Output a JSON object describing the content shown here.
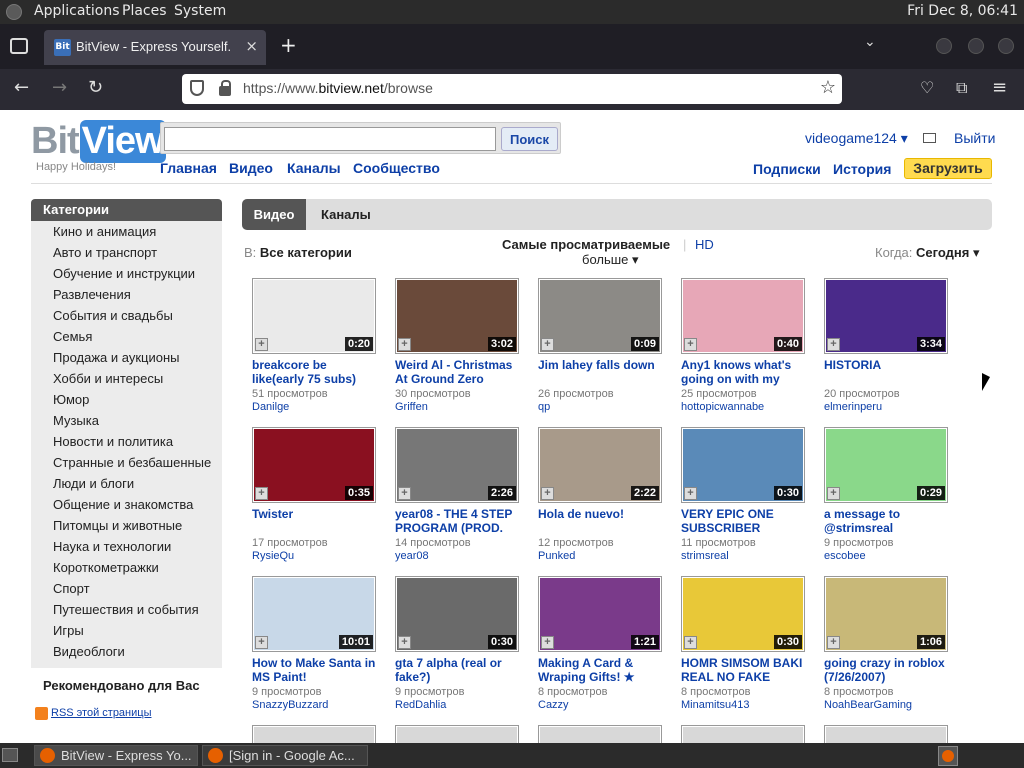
{
  "system_bar": {
    "menus": [
      "Applications",
      "Places",
      "System"
    ],
    "clock": "Fri Dec  8, 06:41"
  },
  "browser": {
    "tab_title": "BitView - Express Yourself.",
    "url_prefix": "https://www.",
    "url_domain": "bitview.net",
    "url_path": "/browse"
  },
  "site": {
    "logo_text": "BitView",
    "tagline": "Happy Holidays!",
    "search_button": "Поиск",
    "nav": [
      "Главная",
      "Видео",
      "Каналы",
      "Сообщество"
    ],
    "username": "videogame124",
    "logout": "Выйти",
    "subs": "Подписки",
    "history": "История",
    "upload": "Загрузить"
  },
  "sidebar": {
    "categories_title": "Категории",
    "categories": [
      "Кино и анимация",
      "Авто и транспорт",
      "Обучение и инструкции",
      "Развлечения",
      "События и свадьбы",
      "Семья",
      "Продажа и аукционы",
      "Хобби и интересы",
      "Юмор",
      "Музыка",
      "Новости и политика",
      "Странные и безбашенные",
      "Люди и блоги",
      "Общение и знакомства",
      "Питомцы и животные",
      "Наука и технологии",
      "Короткометражки",
      "Спорт",
      "Путешествия и события",
      "Игры",
      "Видеоблоги"
    ],
    "recommended": "Рекомендовано для Вас",
    "rss": "RSS этой страницы"
  },
  "browse": {
    "tab_videos": "Видео",
    "tab_channels": "Каналы",
    "in_label": "В:",
    "all_categories": "Все категории",
    "most_viewed": "Самые просматриваемые",
    "hd": "HD",
    "more": "больше",
    "when_label": "Когда:",
    "when_value": "Сегодня"
  },
  "videos": [
    {
      "title": "breakcore be like(early 75 subs)",
      "duration": "0:20",
      "views": "51 просмотров",
      "user": "Danilge",
      "color": "#eaeaea"
    },
    {
      "title": "Weird Al - Christmas At Ground Zero",
      "duration": "3:02",
      "views": "30 просмотров",
      "user": "Griffen",
      "color": "#6a4a3a"
    },
    {
      "title": "Jim lahey falls down",
      "duration": "0:09",
      "views": "26 просмотров",
      "user": "qp",
      "color": "#8c8a86"
    },
    {
      "title": "Any1 knows what's going on with my",
      "duration": "0:40",
      "views": "25 просмотров",
      "user": "hottopicwannabe",
      "color": "#e7a7b7"
    },
    {
      "title": "HISTORIA",
      "duration": "3:34",
      "views": "20 просмотров",
      "user": "elmerinperu",
      "color": "#4a2a8a"
    },
    {
      "title": "Twister",
      "duration": "0:35",
      "views": "17 просмотров",
      "user": "RysieQu",
      "color": "#8a1020"
    },
    {
      "title": "year08 - THE 4 STEP PROGRAM (PROD.",
      "duration": "2:26",
      "views": "14 просмотров",
      "user": "year08",
      "color": "#777777"
    },
    {
      "title": "Hola de nuevo!",
      "duration": "2:22",
      "views": "12 просмотров",
      "user": "Punked",
      "color": "#a89a8a"
    },
    {
      "title": "VERY EPIC ONE SUBSCRIBER",
      "duration": "0:30",
      "views": "11 просмотров",
      "user": "strimsreal",
      "color": "#5a8ab8"
    },
    {
      "title": "a message to @strimsreal",
      "duration": "0:29",
      "views": "9 просмотров",
      "user": "escobee",
      "color": "#8ad88a"
    },
    {
      "title": "How to Make Santa in MS Paint!",
      "duration": "10:01",
      "views": "9 просмотров",
      "user": "SnazzyBuzzard",
      "color": "#c8d8e8"
    },
    {
      "title": "gta 7 alpha (real or fake?)",
      "duration": "0:30",
      "views": "9 просмотров",
      "user": "RedDahlia",
      "color": "#6a6a6a"
    },
    {
      "title": "Making A Card & Wraping Gifts! ★",
      "duration": "1:21",
      "views": "8 просмотров",
      "user": "Cazzy",
      "color": "#7a3a8a"
    },
    {
      "title": "HOMR SIMSOM BAKI REAL NO FAKE",
      "duration": "0:30",
      "views": "8 просмотров",
      "user": "Minamitsu413",
      "color": "#e8c838"
    },
    {
      "title": "going crazy in roblox (7/26/2007)",
      "duration": "1:06",
      "views": "8 просмотров",
      "user": "NoahBearGaming",
      "color": "#c8b878"
    }
  ],
  "taskbar": {
    "items": [
      "BitView - Express Yo...",
      "[Sign in - Google Ac..."
    ]
  }
}
